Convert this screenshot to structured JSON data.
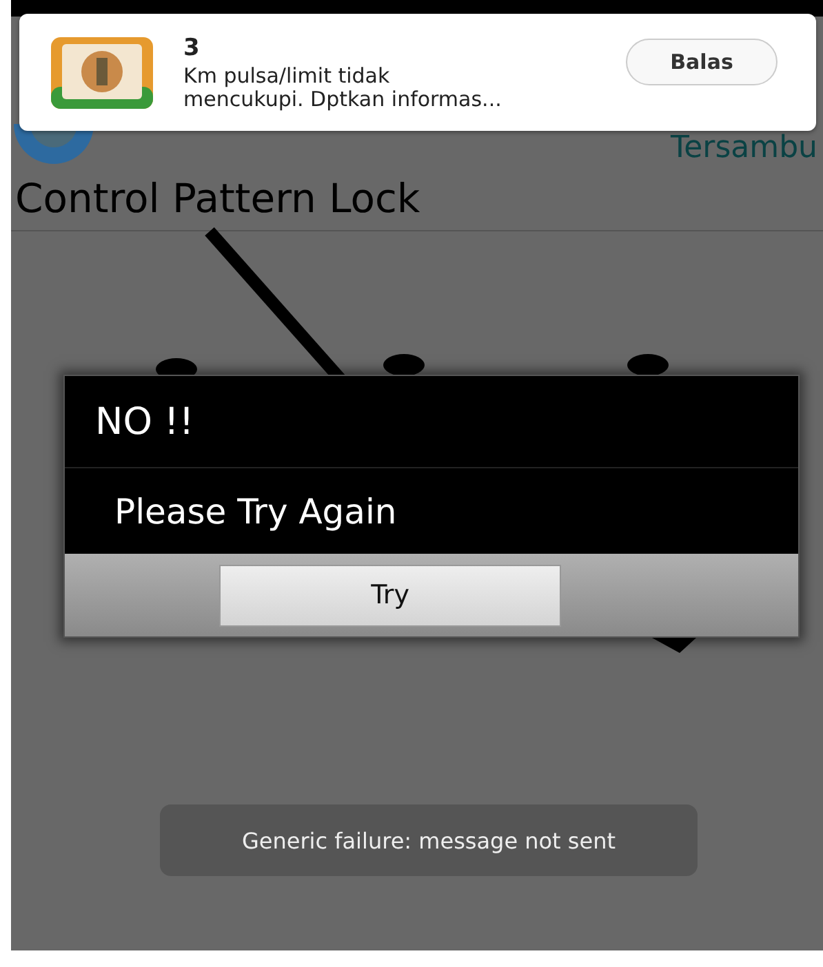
{
  "notification": {
    "sender": "3",
    "message_lines": [
      "Km pulsa/limit tidak",
      "mencukupi. Dptkan informas..."
    ],
    "button": "Balas"
  },
  "app": {
    "header_text": "Tersambu",
    "title": "Control Pattern Lock"
  },
  "dialog": {
    "title": "NO !!",
    "message": "Please Try Again",
    "button": "Try"
  },
  "toast": {
    "message": "Generic failure: message not sent"
  }
}
